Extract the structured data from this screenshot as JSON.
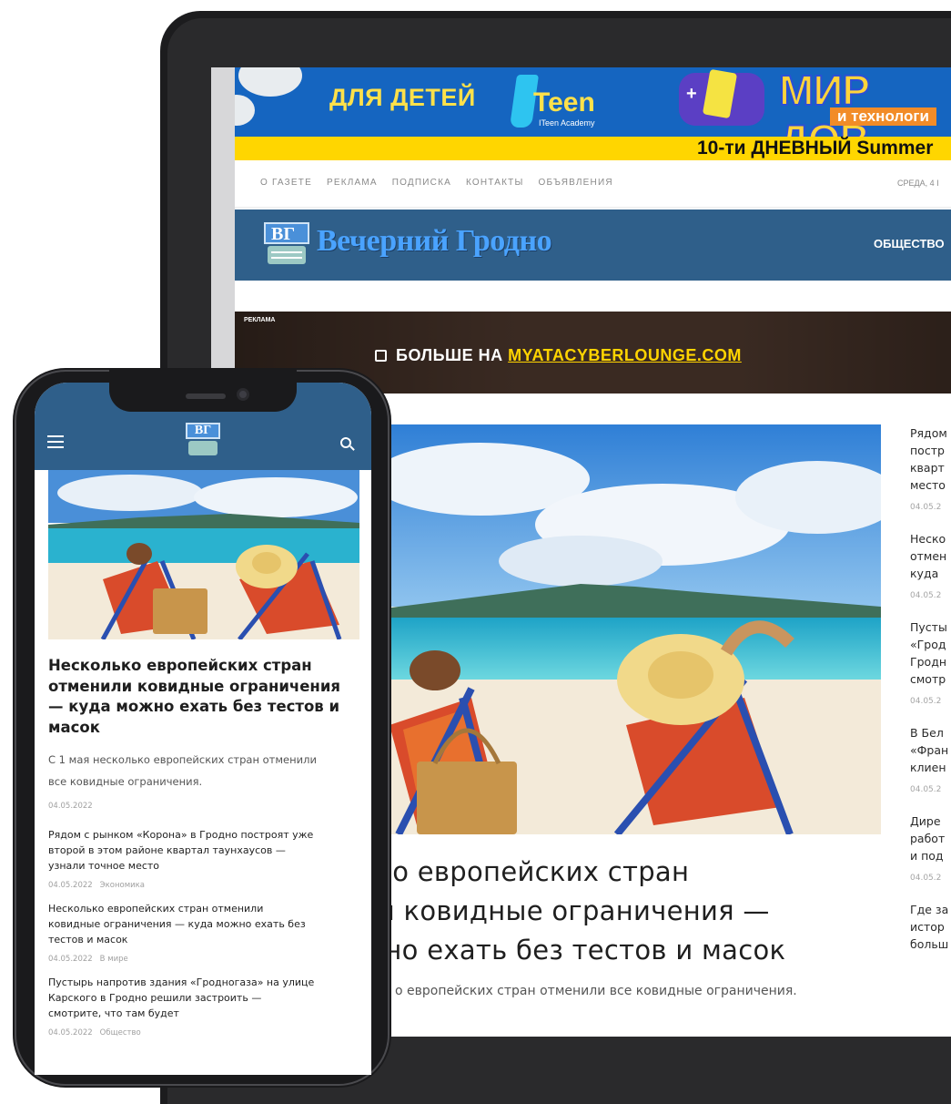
{
  "banner": {
    "kids_text": "ДЛЯ ДЕТЕЙ",
    "iteen_word": "Teen",
    "iteen_sub": "ITeen Academy",
    "mir_text": "МИР ДОВ",
    "tech_text": "и технологи",
    "summer_text": "10-ти ДНЕВНЫЙ Summer"
  },
  "topnav": {
    "items": [
      "О ГАЗЕТЕ",
      "РЕКЛАМА",
      "ПОДПИСКА",
      "КОНТАКТЫ",
      "ОБЪЯВЛЕНИЯ"
    ],
    "date": "СРЕДА, 4 І"
  },
  "header": {
    "logo_mark": "ВГ",
    "logo_text": "Вечерний Гродно",
    "nav_first": "ОБЩЕСТВО"
  },
  "ad": {
    "label": "РЕКЛАМА",
    "prefix": "БОЛЬШЕ НА ",
    "domain": "MYATACYBERLOUNGE.COM"
  },
  "hero": {
    "title_lines": [
      "ько европейских стран",
      "ли ковидные ограничения —",
      "жно ехать без тестов и масок"
    ],
    "lead": "о европейских стран отменили все ковидные ограничения."
  },
  "right_column": [
    {
      "lines": [
        "Рядом",
        "постр",
        "кварт",
        "место"
      ],
      "date": "04.05.2"
    },
    {
      "lines": [
        "Неско",
        "отмен",
        "куда"
      ],
      "date": "04.05.2"
    },
    {
      "lines": [
        "Пусты",
        "«Грод",
        "Гродн",
        "смотр"
      ],
      "date": "04.05.2"
    },
    {
      "lines": [
        "В Бел",
        "«Фран",
        "клиен"
      ],
      "date": "04.05.2"
    },
    {
      "lines": [
        "Дире",
        "работ",
        "и под"
      ],
      "date": "04.05.2"
    },
    {
      "lines": [
        "Где за",
        "истор",
        "больш"
      ],
      "date": ""
    }
  ],
  "phone": {
    "logo_mark": "ВГ",
    "title_lines": [
      "Несколько европейских стран",
      "отменили ковидные ограничения",
      "— куда можно ехать без тестов и",
      "масок"
    ],
    "lead_lines": [
      "С 1 мая несколько европейских стран отменили",
      "все ковидные ограничения."
    ],
    "date": "04.05.2022",
    "items": [
      {
        "lines": [
          "Рядом с рынком «Корона» в Гродно построят уже",
          "второй в этом районе квартал таунхаусов —",
          "узнали точное место"
        ],
        "date": "04.05.2022",
        "category": "Экономика"
      },
      {
        "lines": [
          "Несколько европейских стран отменили",
          "ковидные ограничения — куда можно ехать без",
          "тестов и масок"
        ],
        "date": "04.05.2022",
        "category": "В мире"
      },
      {
        "lines": [
          "Пустырь напротив здания «Гродногаза» на улице",
          "Карского в Гродно решили застроить —",
          "смотрите, что там будет"
        ],
        "date": "04.05.2022",
        "category": "Общество"
      }
    ]
  }
}
